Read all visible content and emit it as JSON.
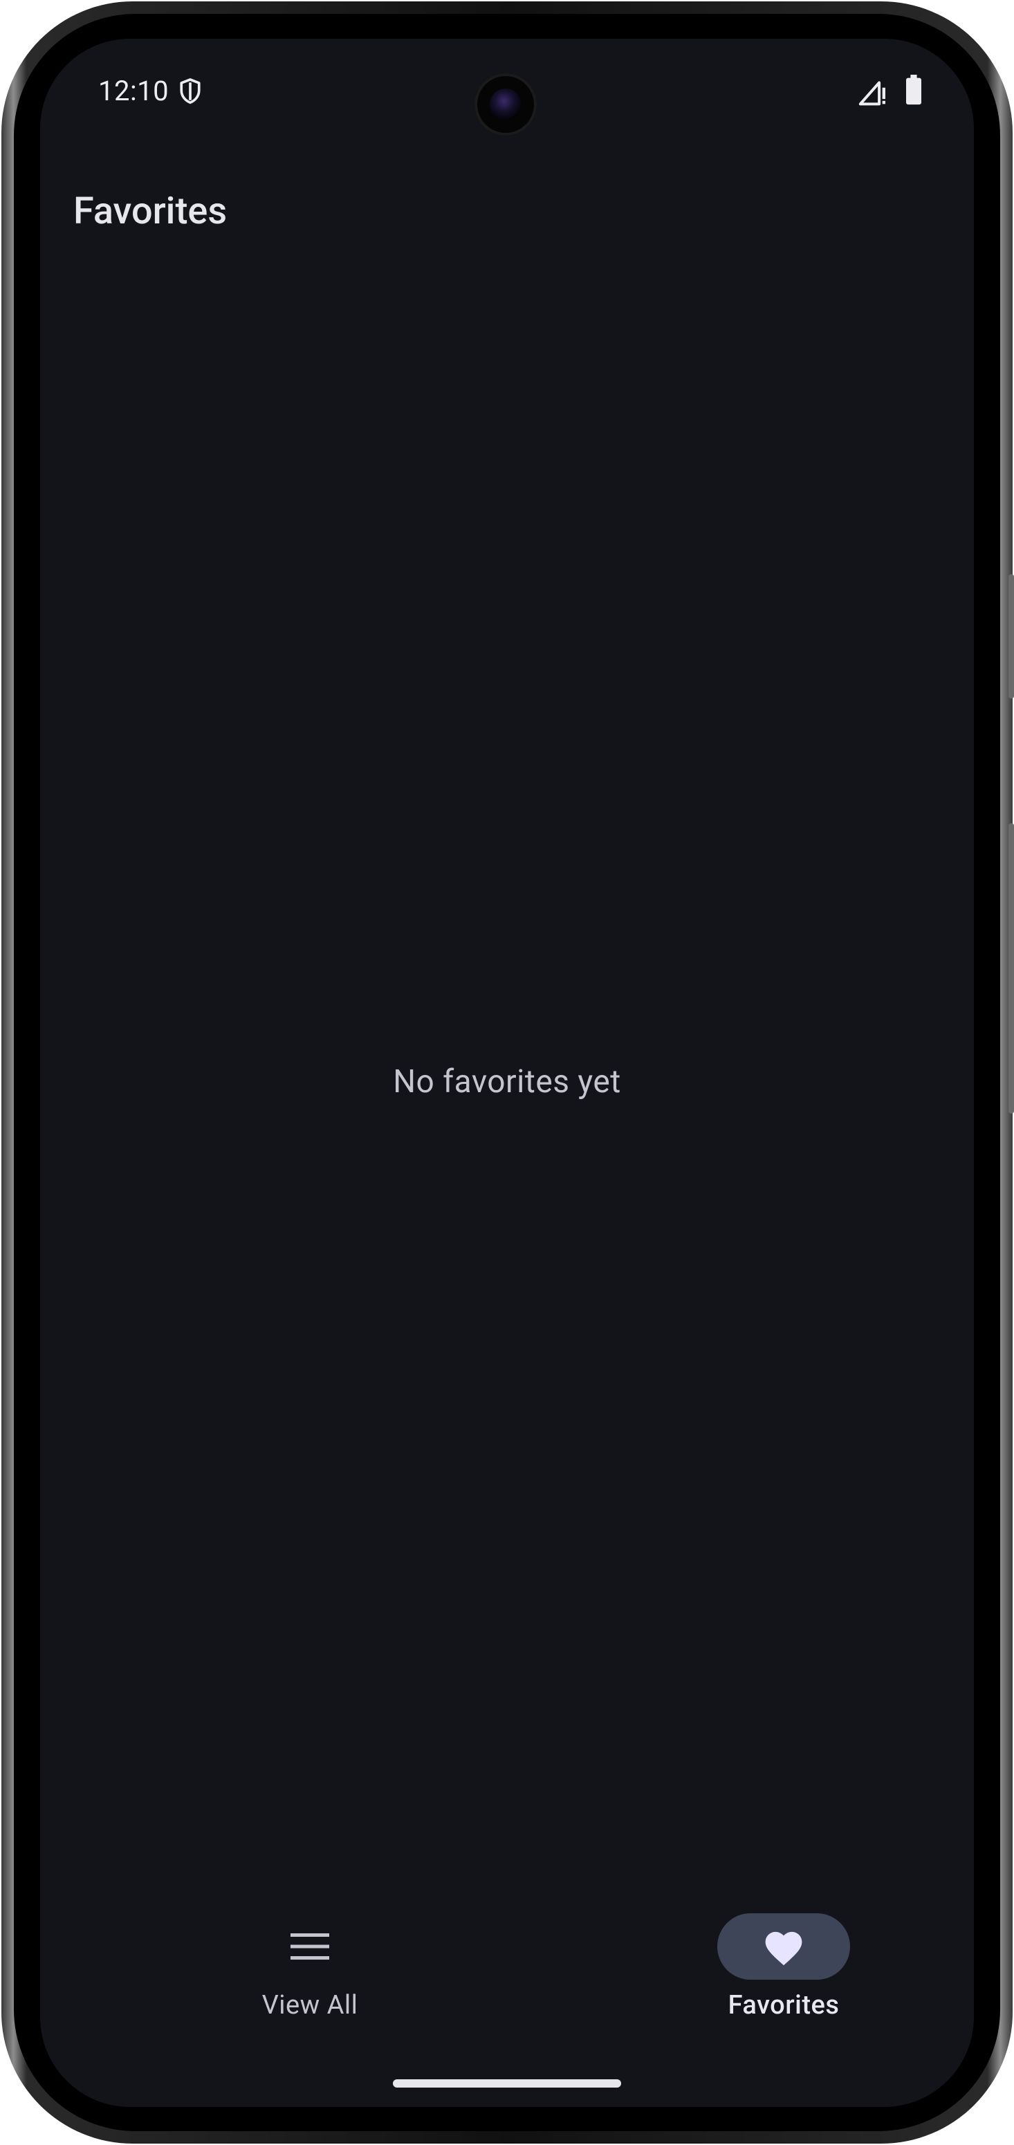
{
  "status_bar": {
    "time": "12:10",
    "icons": [
      "shield-icon",
      "signal-icon",
      "battery-icon"
    ]
  },
  "header": {
    "title": "Favorites"
  },
  "main": {
    "empty_message": "No favorites yet"
  },
  "bottom_nav": {
    "items": [
      {
        "label": "View All",
        "icon": "menu-icon",
        "selected": false
      },
      {
        "label": "Favorites",
        "icon": "heart-icon",
        "selected": true
      }
    ]
  },
  "colors": {
    "background": "#131419",
    "active_indicator": "#3e4558",
    "heart": "#e7e4ff",
    "text_primary": "#e6e6ec",
    "text_secondary": "#c4c5ce"
  }
}
